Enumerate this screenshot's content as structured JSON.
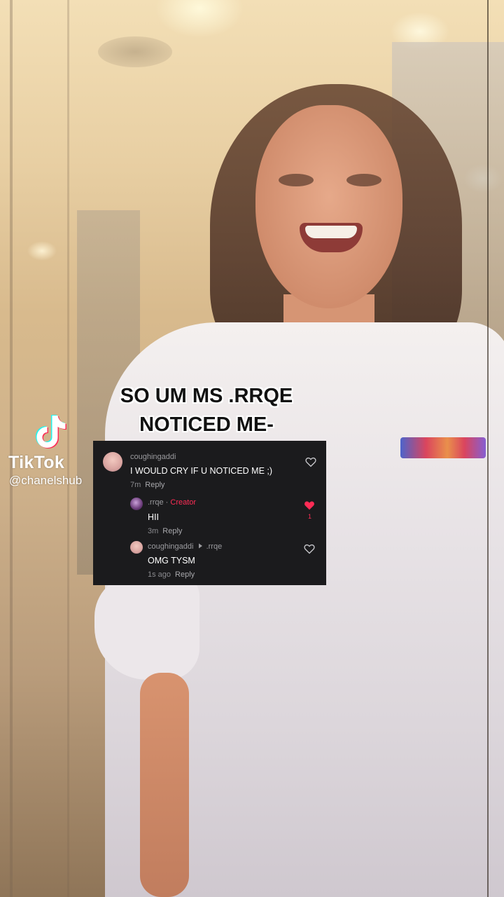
{
  "overlay": {
    "caption_line1": "SO UM MS .RRQE",
    "caption_line2": "NOTICED ME-"
  },
  "watermark": {
    "brand": "TikTok",
    "handle": "@chanelshub"
  },
  "comments": [
    {
      "user": "coughingaddi",
      "text": "I WOULD CRY IF U NOTICED ME ;)",
      "time": "7m",
      "reply": "Reply",
      "liked": false
    },
    {
      "user": ".rrqe",
      "separator": " · ",
      "badge": "Creator",
      "text": "HII",
      "time": "3m",
      "reply": "Reply",
      "liked": true,
      "likes": "1"
    },
    {
      "user": "coughingaddi",
      "reply_to": ".rrqe",
      "text": "OMG TYSM",
      "time": "1s ago",
      "reply": "Reply",
      "liked": false
    }
  ],
  "colors": {
    "panel_bg": "#1b1b1d",
    "accent": "#fe2c55"
  }
}
